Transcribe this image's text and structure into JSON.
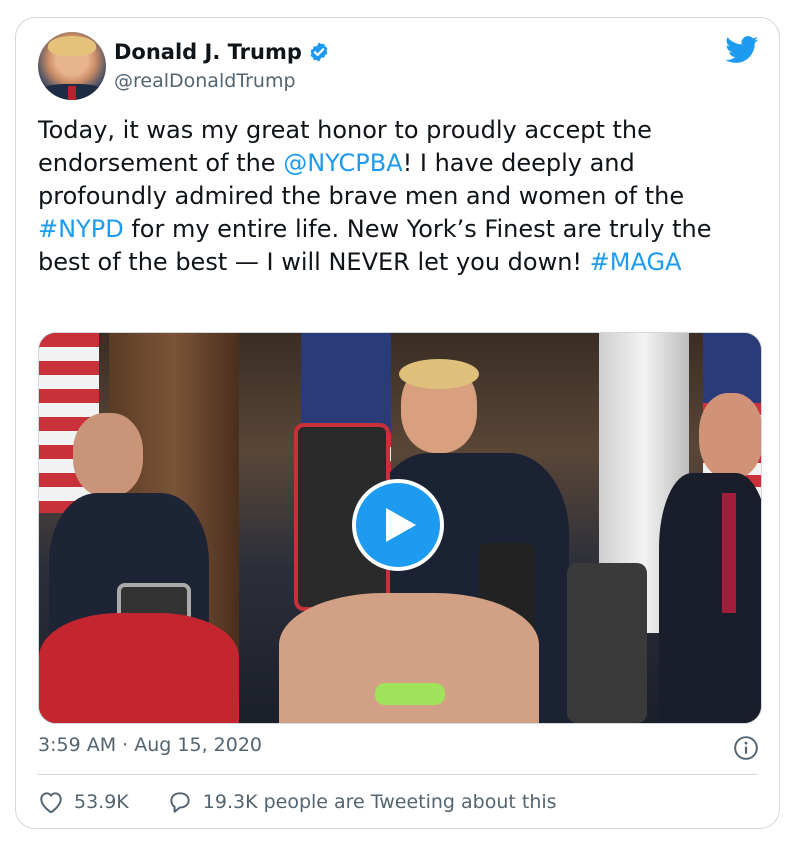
{
  "author": {
    "name": "Donald J. Trump",
    "handle": "@realDonaldTrump",
    "verified": true
  },
  "tweet": {
    "segments": [
      {
        "text": "Today, it was my great honor to proudly accept the endorsement of the ",
        "type": "text"
      },
      {
        "text": "@NYCPBA",
        "type": "link"
      },
      {
        "text": "! I have deeply and profoundly admired the brave men and women of the ",
        "type": "text"
      },
      {
        "text": "#NYPD",
        "type": "link"
      },
      {
        "text": " for my entire life. New York’s Finest are truly the best of the best — I will NEVER let you down! ",
        "type": "text"
      },
      {
        "text": "#MAGA",
        "type": "link"
      }
    ]
  },
  "media": {
    "type": "video",
    "play_icon": "play-icon"
  },
  "meta": {
    "time": "3:59 AM",
    "separator": "·",
    "date": "Aug 15, 2020"
  },
  "actions": {
    "likes": "53.9K",
    "replies_text": "19.3K people are Tweeting about this"
  },
  "colors": {
    "link": "#1d9bf0",
    "text": "#0f1419",
    "muted": "#536471",
    "border": "#cfd9de"
  },
  "icons": [
    "verified-badge-icon",
    "twitter-bird-icon",
    "play-icon",
    "info-icon",
    "heart-icon",
    "comment-icon"
  ]
}
